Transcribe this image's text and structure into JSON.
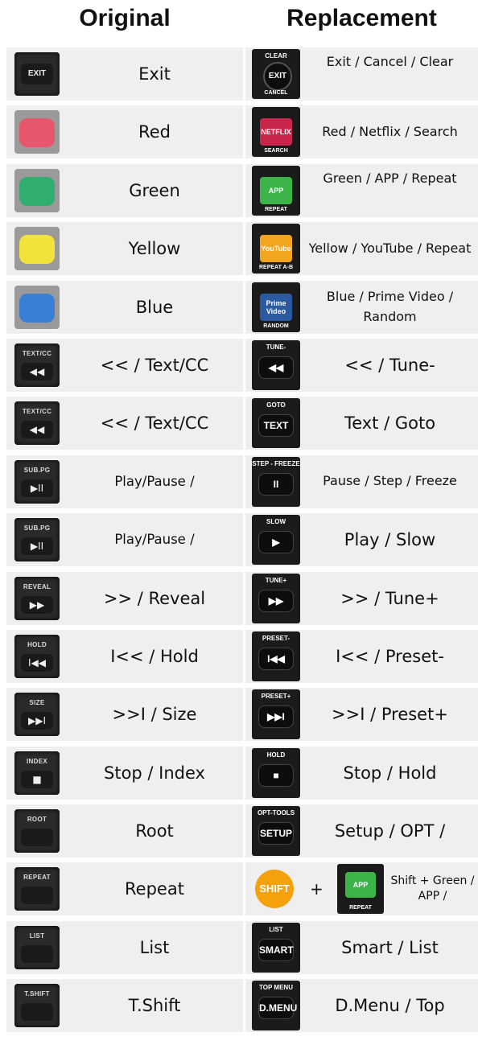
{
  "headers": {
    "original": "Original",
    "replacement": "Replacement"
  },
  "rows": [
    {
      "orig": {
        "icon": "exit",
        "label": "EXIT",
        "text": "Exit"
      },
      "repl": {
        "type": "round",
        "top": "CLEAR",
        "main": "EXIT",
        "bot": "CANCEL",
        "text": "Exit / Cancel / Clear",
        "small": true,
        "topalign": true
      }
    },
    {
      "orig": {
        "icon": "color",
        "color": "#e8566e",
        "text": "Red"
      },
      "repl": {
        "type": "sq",
        "main": "NETFLIX",
        "bot": "SEARCH",
        "color": "#c8264a",
        "text": "Red / Netflix / Search",
        "small": true
      }
    },
    {
      "orig": {
        "icon": "color",
        "color": "#2fae6f",
        "text": "Green"
      },
      "repl": {
        "type": "sq",
        "main": "APP",
        "bot": "REPEAT",
        "color": "#3cb44a",
        "text": "Green / APP / Repeat",
        "small": true,
        "topalign": true
      }
    },
    {
      "orig": {
        "icon": "color",
        "color": "#f2e23a",
        "text": "Yellow"
      },
      "repl": {
        "type": "sq",
        "main": "YouTube",
        "bot": "REPEAT A-B",
        "color": "#f2a51e",
        "text": "Yellow / YouTube / Repeat",
        "small": true
      }
    },
    {
      "orig": {
        "icon": "color",
        "color": "#3a7fd6",
        "text": "Blue"
      },
      "repl": {
        "type": "sq",
        "main": "Prime Video",
        "bot": "RANDOM",
        "color": "#2c5aa0",
        "text": "Blue / Prime Video / Random",
        "small": true
      }
    },
    {
      "orig": {
        "icon": "btn",
        "label": "TEXT/CC",
        "sym": "◀◀",
        "text": "<< / Text/CC"
      },
      "repl": {
        "type": "pill",
        "top": "TUNE-",
        "main": "◀◀",
        "text": "<< / Tune-"
      }
    },
    {
      "orig": {
        "icon": "btn",
        "label": "TEXT/CC",
        "sym": "◀◀",
        "text": "<< / Text/CC"
      },
      "repl": {
        "type": "pill",
        "top": "GOTO",
        "main": "TEXT",
        "text": "Text / Goto"
      }
    },
    {
      "orig": {
        "icon": "btn",
        "label": "SUB.PG",
        "sym": "▶II",
        "text": "Play/Pause /",
        "small": true
      },
      "repl": {
        "type": "pill",
        "top": "STEP - FREEZE",
        "main": "II",
        "text": "Pause / Step / Freeze",
        "small": true
      }
    },
    {
      "orig": {
        "icon": "btn",
        "label": "SUB.PG",
        "sym": "▶II",
        "text": "Play/Pause /",
        "small": true
      },
      "repl": {
        "type": "pill",
        "top": "SLOW",
        "main": "▶",
        "text": "Play / Slow"
      }
    },
    {
      "orig": {
        "icon": "btn",
        "label": "REVEAL",
        "sym": "▶▶",
        "text": ">> / Reveal"
      },
      "repl": {
        "type": "pill",
        "top": "TUNE+",
        "main": "▶▶",
        "text": ">> / Tune+"
      }
    },
    {
      "orig": {
        "icon": "btn",
        "label": "HOLD",
        "sym": "I◀◀",
        "text": "I<< / Hold"
      },
      "repl": {
        "type": "pill",
        "top": "PRESET-",
        "main": "I◀◀",
        "text": "I<< / Preset-"
      }
    },
    {
      "orig": {
        "icon": "btn",
        "label": "SIZE",
        "sym": "▶▶I",
        "text": ">>I / Size"
      },
      "repl": {
        "type": "pill",
        "top": "PRESET+",
        "main": "▶▶I",
        "text": ">>I / Preset+"
      }
    },
    {
      "orig": {
        "icon": "btn",
        "label": "INDEX",
        "sym": "■",
        "text": "Stop / Index"
      },
      "repl": {
        "type": "pill",
        "top": "HOLD",
        "main": "■",
        "text": "Stop / Hold"
      }
    },
    {
      "orig": {
        "icon": "btn",
        "label": "ROOT",
        "sym": "",
        "text": "Root"
      },
      "repl": {
        "type": "pill",
        "top": "OPT-TOOLS",
        "main": "SETUP",
        "text": "Setup / OPT /"
      }
    },
    {
      "orig": {
        "icon": "btn",
        "label": "REPEAT",
        "sym": "",
        "text": "Repeat"
      },
      "repl": {
        "type": "combo",
        "shift": "SHIFT",
        "plus": "+",
        "main": "APP",
        "bot": "REPEAT",
        "color": "#3cb44a",
        "text": "Shift + Green / APP /"
      }
    },
    {
      "orig": {
        "icon": "btn",
        "label": "LIST",
        "sym": "",
        "text": "List"
      },
      "repl": {
        "type": "pill",
        "top": "LIST",
        "main": "SMART",
        "text": "Smart / List"
      }
    },
    {
      "orig": {
        "icon": "btn",
        "label": "T.SHIFT",
        "sym": "",
        "text": "T.Shift"
      },
      "repl": {
        "type": "pill",
        "top": "TOP MENU",
        "main": "D.MENU",
        "text": "D.Menu / Top"
      }
    }
  ]
}
